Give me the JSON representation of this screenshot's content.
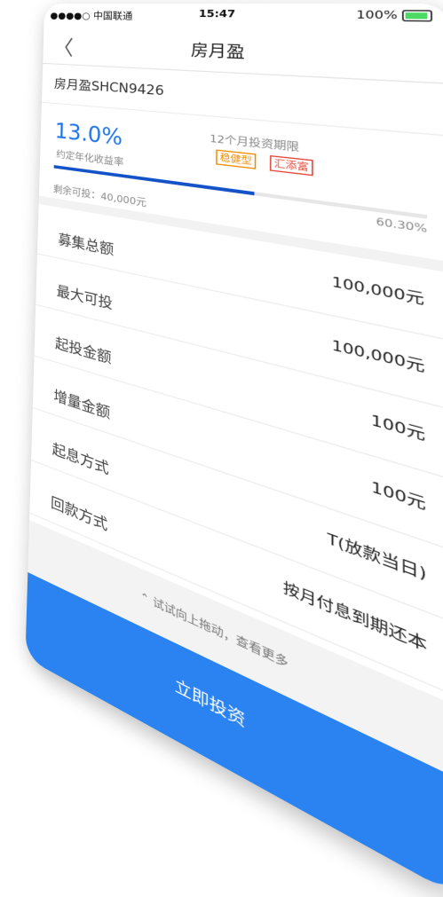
{
  "status_bar": {
    "carrier": "●●●●○ 中国联通",
    "time": "15:47",
    "battery": "100%"
  },
  "nav": {
    "back": "〈",
    "title": "房月盈"
  },
  "product": {
    "name": "房月盈SHCN9426",
    "rate": "13.0%",
    "rate_label": "约定年化收益率",
    "term": "12个月投资期限",
    "tags": [
      "稳健型",
      "汇添富"
    ],
    "progress_percent": "60.30%",
    "progress_value": 60.3,
    "remaining": "剩余可投：40,000元"
  },
  "details": [
    {
      "label": "募集总额",
      "value": "100,000元"
    },
    {
      "label": "最大可投",
      "value": "100,000元"
    },
    {
      "label": "起投金额",
      "value": "100元"
    },
    {
      "label": "增量金额",
      "value": "100元"
    },
    {
      "label": "起息方式",
      "value": "T(放款当日)"
    },
    {
      "label": "回款方式",
      "value": "按月付息到期还本"
    }
  ],
  "hint": "⌃ 试试向上拖动，查看更多",
  "invest_button": "立即投资",
  "colors": {
    "accent_blue": "#1e74e8",
    "button_blue": "#2a83f0",
    "tag_orange": "#f08b00",
    "tag_red": "#e34a3c"
  }
}
